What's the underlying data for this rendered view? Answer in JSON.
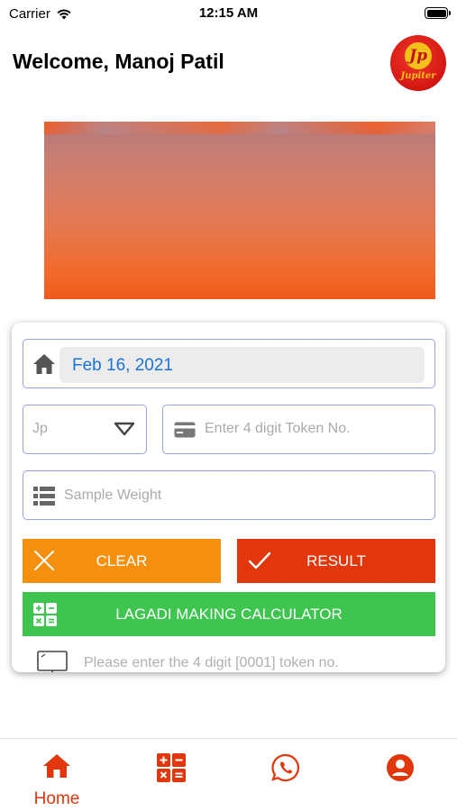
{
  "status_bar": {
    "carrier": "Carrier",
    "time": "12:15 AM"
  },
  "header": {
    "title": "Welcome, Manoj Patil",
    "logo_mark": "Jp",
    "logo_text": "Jupiter"
  },
  "form": {
    "date_value": "Feb 16, 2021",
    "select_value": "Jp",
    "token_placeholder": "Enter 4 digit Token No.",
    "weight_placeholder": "Sample Weight",
    "clear_label": "CLEAR",
    "result_label": "RESULT",
    "calculator_label": "LAGADI MAKING CALCULATOR",
    "hint": "Please enter the 4 digit [0001] token no."
  },
  "tab_bar": {
    "items": [
      {
        "icon": "home-icon",
        "label": "Home",
        "active": true
      },
      {
        "icon": "calculator-icon",
        "label": "",
        "active": false
      },
      {
        "icon": "whatsapp-icon",
        "label": "",
        "active": false
      },
      {
        "icon": "profile-icon",
        "label": "",
        "active": false
      }
    ]
  },
  "colors": {
    "accent": "#e2360c",
    "clear": "#f5900e",
    "result": "#e2360c",
    "calculator": "#3dc54f",
    "date_text": "#1a73d6",
    "field_border": "#9aa0e6"
  }
}
